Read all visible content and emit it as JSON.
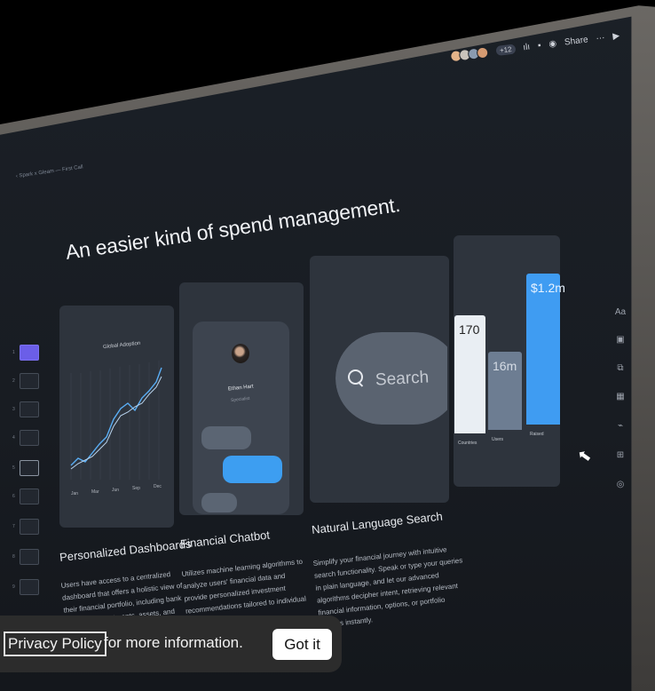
{
  "topbar": {
    "avatar_count": "+12",
    "share_label": "Share",
    "more_label": "···",
    "play_label": "▶",
    "avatar_colors": [
      "#e4b48a",
      "#c9c3bb",
      "#8a9bb0",
      "#d59b72"
    ]
  },
  "breadcrumb": "Spark x Gleam — First Call",
  "headline": "An easier kind of spend management.",
  "dashboard_card": {
    "chart_title": "Global Adoption",
    "months": [
      "Jan",
      "Mar",
      "Jun",
      "Sep",
      "Dec"
    ]
  },
  "chatbot_card": {
    "name": "Ethan Hart",
    "role": "Specialist"
  },
  "search_card": {
    "placeholder": "Search"
  },
  "chart_data": {
    "type": "bar",
    "categories": [
      "Countries",
      "Users",
      "Raised"
    ],
    "value_labels": [
      "170",
      "16m",
      "$1.2m"
    ],
    "relative_heights": [
      0.78,
      0.52,
      1.0
    ],
    "colors": [
      "#e9eef3",
      "#6d7d92",
      "#3f9cf2"
    ]
  },
  "features": [
    {
      "title": "Personalized Dashboards",
      "desc": "Users have access to a centralized dashboard that offers a holistic view of their financial portfolio, including bank accounts, investments, assets, and"
    },
    {
      "title": "Financial Chatbot",
      "desc": "Utilizes machine learning algorithms to analyze users' financial data and provide personalized investment recommendations tailored to individual goals, risk"
    },
    {
      "title": "Natural Language Search",
      "desc": "Simplify your financial journey with intuitive search functionality. Speak or type your queries in plain language, and let our advanced algorithms decipher intent, retrieving relevant financial information, options, or portfolio insights instantly."
    }
  ],
  "thumbnails": [
    "1",
    "2",
    "3",
    "4",
    "5",
    "6",
    "7",
    "8",
    "9"
  ],
  "right_toolbar": [
    "Aa",
    "▣",
    "⧉",
    "▦",
    "⌁",
    "⊞",
    "◎"
  ],
  "cookie_banner": {
    "link_label": "Privacy Policy",
    "text": "for more information.",
    "button_label": "Got it"
  }
}
